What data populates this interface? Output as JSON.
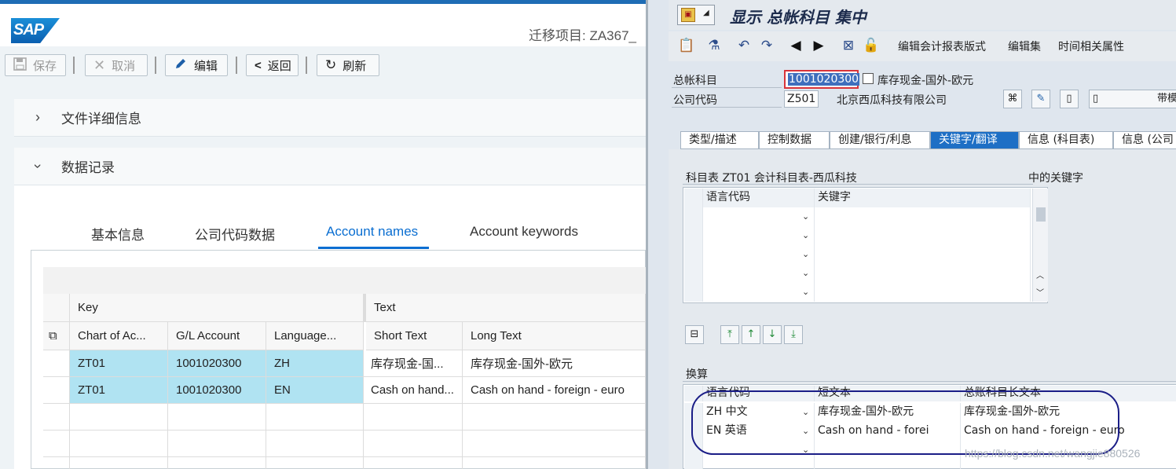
{
  "left": {
    "logo_text": "SAP",
    "migration_label": "迁移项目: ZA367_",
    "toolbar": {
      "save": "保存",
      "cancel": "取消",
      "edit": "编辑",
      "back": "返回",
      "refresh": "刷新"
    },
    "sections": {
      "file_details": "文件详细信息",
      "data_records": "数据记录"
    },
    "tabs": [
      "基本信息",
      "公司代码数据",
      "Account names",
      "Account keywords"
    ],
    "table": {
      "group_key": "Key",
      "group_text": "Text",
      "columns": [
        "Chart of Ac...",
        "G/L Account",
        "Language...",
        "Short Text",
        "Long Text"
      ],
      "rows": [
        [
          "ZT01",
          "1001020300",
          "ZH",
          "库存现金-国...",
          "库存现金-国外-欧元"
        ],
        [
          "ZT01",
          "1001020300",
          "EN",
          "Cash on hand...",
          "Cash on hand - foreign - euro"
        ]
      ]
    }
  },
  "right": {
    "title": "显示 总帐科目 集中",
    "toolbar_menu": [
      "编辑会计报表版式",
      "编辑集",
      "时间相关属性"
    ],
    "gl_account_label": "总帐科目",
    "gl_account_value": "1001020300",
    "gl_account_desc": "库存现金-国外-欧元",
    "company_code_label": "公司代码",
    "company_code_value": "Z501",
    "company_name": "北京西瓜科技有限公司",
    "template_label": "带模",
    "tabs": [
      "类型/描述",
      "控制数据",
      "创建/银行/利息",
      "关键字/翻译",
      "信息 (科目表)",
      "信息 (公司"
    ],
    "keyword_heading": "科目表 ZT01 会计科目表-西瓜科技",
    "keyword_heading_right": "中的关键字",
    "keyword_cols": [
      "语言代码",
      "关键字"
    ],
    "translation_heading": "换算",
    "translation_cols": [
      "语言代码",
      "短文本",
      "总账科目长文本"
    ],
    "translation_rows": [
      [
        "ZH 中文",
        "库存现金-国外-欧元",
        "库存现金-国外-欧元"
      ],
      [
        "EN 英语",
        "Cash on hand - forei",
        "Cash on hand - foreign - euro"
      ]
    ],
    "watermark": "https://blog.csdn.net/wangjie880526"
  }
}
